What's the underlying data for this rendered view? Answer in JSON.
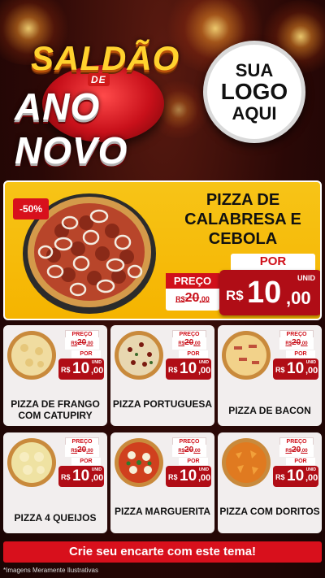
{
  "header": {
    "title_line1": "SALDÃO",
    "title_de": "DE",
    "title_line2": "ANO NOVO",
    "logo": {
      "line1": "SUA",
      "line2": "LOGO",
      "line3": "AQUI"
    }
  },
  "featured": {
    "discount": "-50%",
    "name": "PIZZA DE CALABRESA E CEBOLA",
    "preco_label": "PREÇO",
    "old_price_currency": "R$",
    "old_price_int": "20",
    "old_price_dec": ",00",
    "por_label": "POR",
    "unid_label": "UNID",
    "new_price_currency": "R$",
    "new_price_int": "10",
    "new_price_dec": ",00"
  },
  "products": [
    {
      "name": "PIZZA DE FRANGO COM CATUPIRY",
      "preco_label": "PREÇO",
      "old_currency": "R$",
      "old_int": "20",
      "old_dec": ",00",
      "por_label": "POR",
      "currency": "R$",
      "int": "10",
      "dec": ",00",
      "unid": "UNID"
    },
    {
      "name": "PIZZA PORTUGUESA",
      "preco_label": "PREÇO",
      "old_currency": "R$",
      "old_int": "20",
      "old_dec": ",00",
      "por_label": "POR",
      "currency": "R$",
      "int": "10",
      "dec": ",00",
      "unid": "UNID"
    },
    {
      "name": "PIZZA DE BACON",
      "preco_label": "PREÇO",
      "old_currency": "R$",
      "old_int": "20",
      "old_dec": ",00",
      "por_label": "POR",
      "currency": "R$",
      "int": "10",
      "dec": ",00",
      "unid": "UNID"
    },
    {
      "name": "PIZZA 4 QUEIJOS",
      "preco_label": "PREÇO",
      "old_currency": "R$",
      "old_int": "20",
      "old_dec": ",00",
      "por_label": "POR",
      "currency": "R$",
      "int": "10",
      "dec": ",00",
      "unid": "UNID"
    },
    {
      "name": "PIZZA MARGUERITA",
      "preco_label": "PREÇO",
      "old_currency": "R$",
      "old_int": "20",
      "old_dec": ",00",
      "por_label": "POR",
      "currency": "R$",
      "int": "10",
      "dec": ",00",
      "unid": "UNID"
    },
    {
      "name": "PIZZA COM DORITOS",
      "preco_label": "PREÇO",
      "old_currency": "R$",
      "old_int": "20",
      "old_dec": ",00",
      "por_label": "POR",
      "currency": "R$",
      "int": "10",
      "dec": ",00",
      "unid": "UNID"
    }
  ],
  "cta": "Crie seu encarte com este tema!",
  "disclaimer": "*Imagens Meramente Ilustrativas",
  "colors": {
    "accent_red": "#d0101a",
    "price_red": "#b00d16",
    "featured_yellow": "#f5b400",
    "card_bg": "#f2eeee"
  }
}
